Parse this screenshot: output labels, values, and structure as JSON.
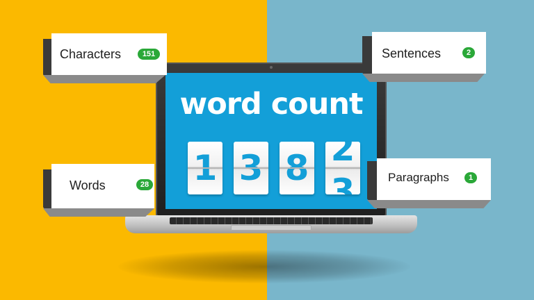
{
  "colors": {
    "left_background": "#fbb900",
    "right_background": "#79b6cb",
    "screen": "#139fd8",
    "badge": "#2aa838"
  },
  "screen": {
    "title": "word count",
    "digits": [
      "1",
      "3",
      "8"
    ],
    "flipping_digit": {
      "top": "2",
      "bottom": "3"
    }
  },
  "stats": {
    "characters": {
      "label": "Characters",
      "count": "151"
    },
    "words": {
      "label": "Words",
      "count": "28"
    },
    "sentences": {
      "label": "Sentences",
      "count": "2"
    },
    "paragraphs": {
      "label": "Paragraphs",
      "count": "1"
    }
  }
}
